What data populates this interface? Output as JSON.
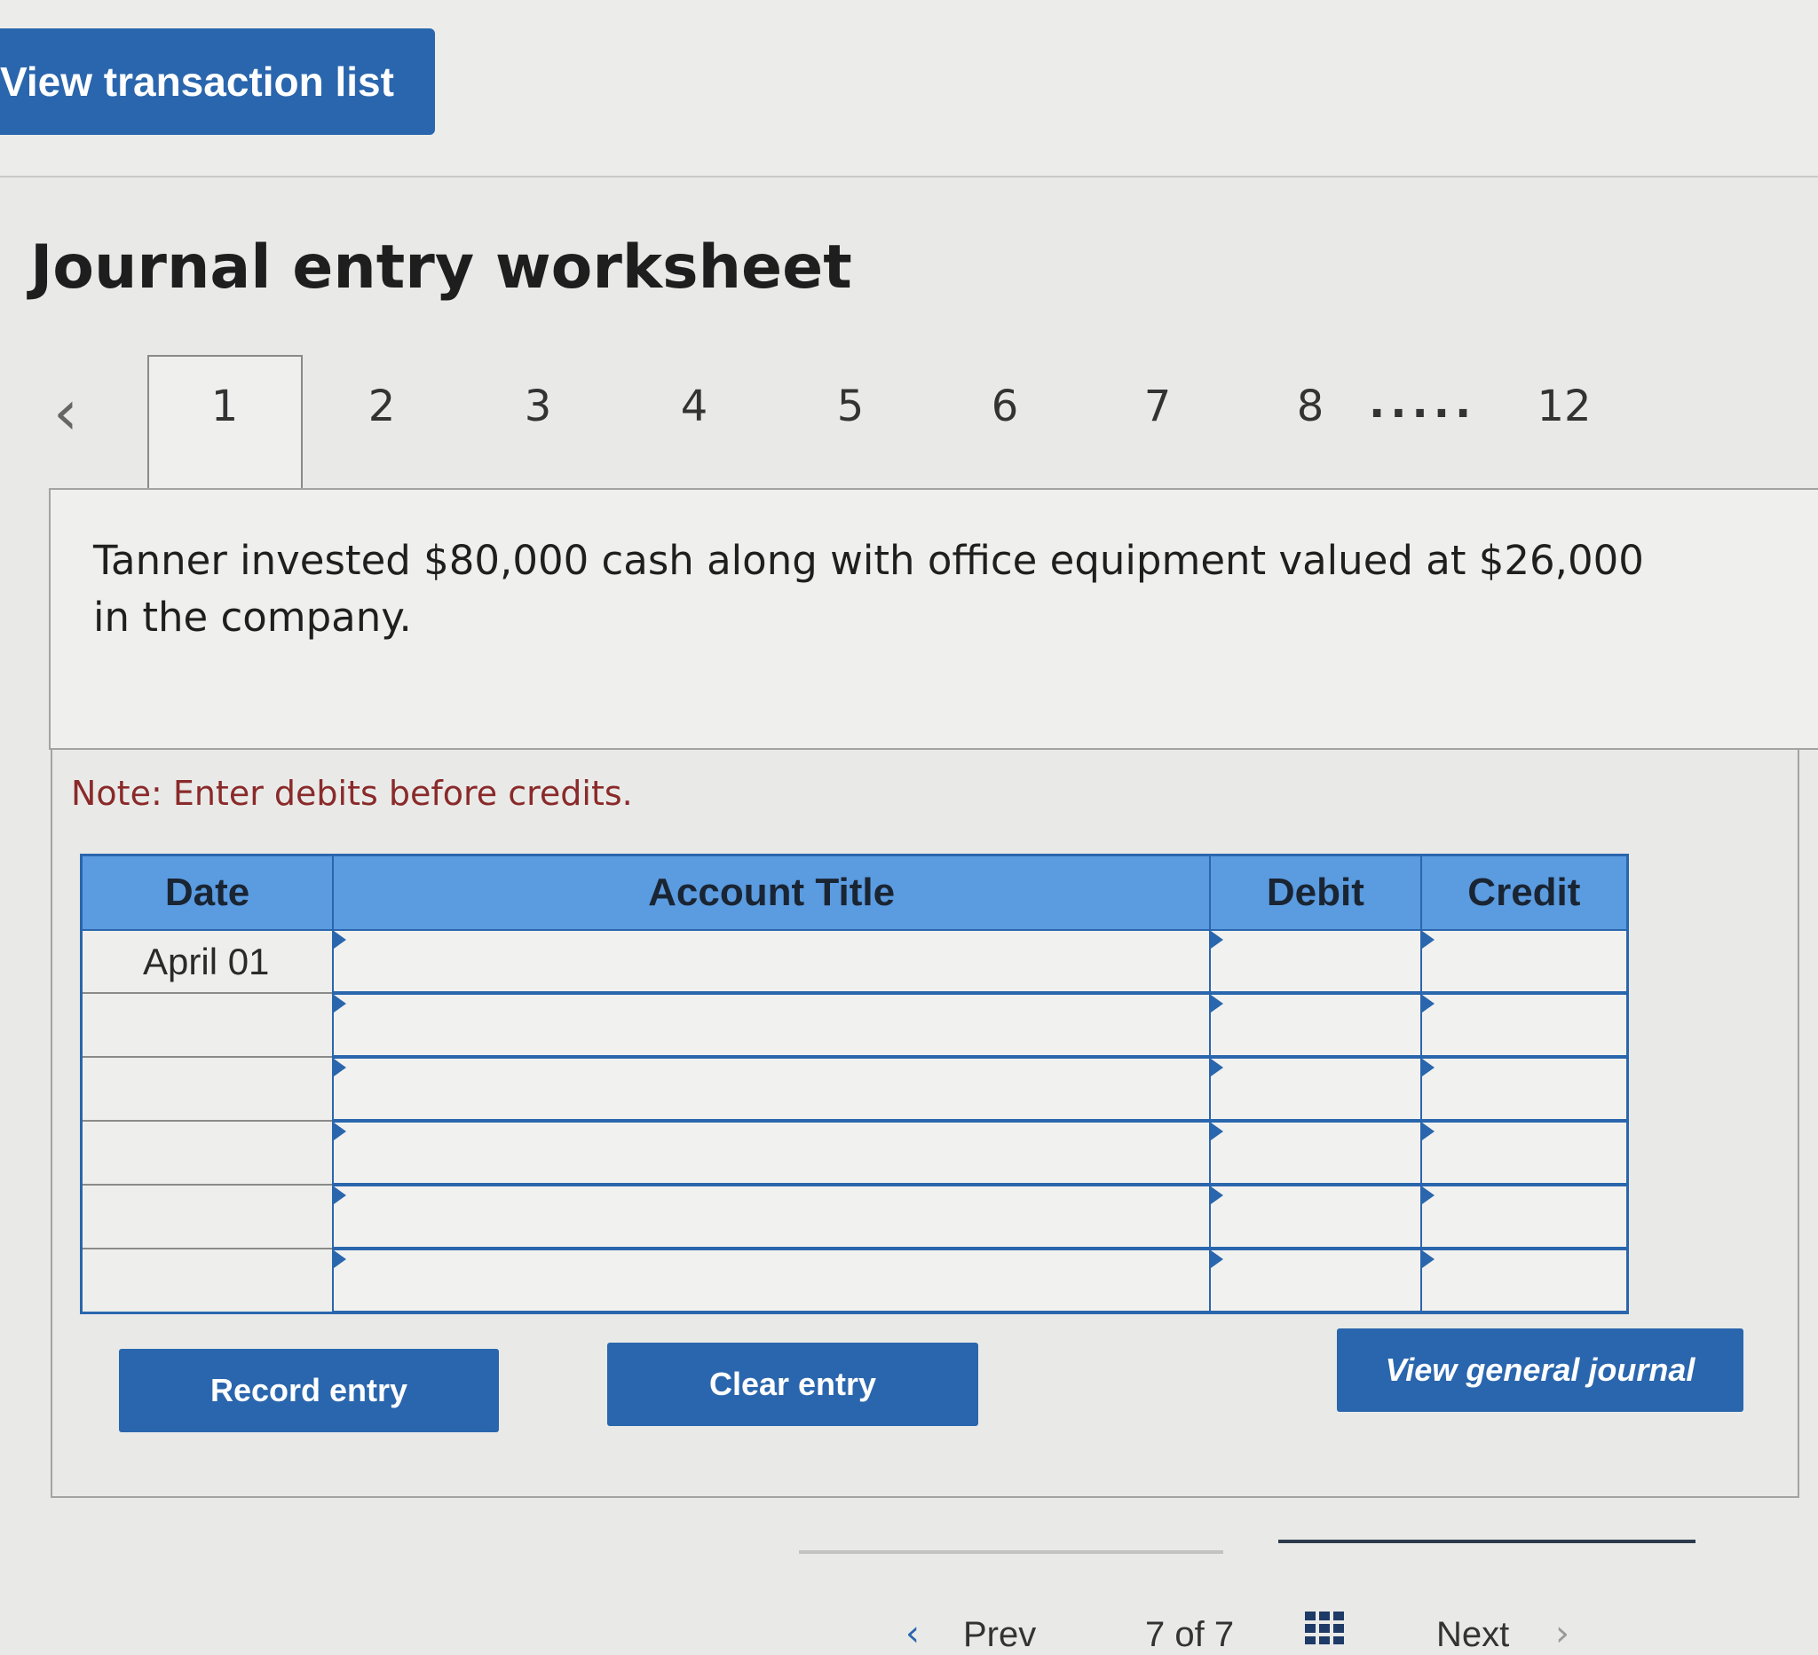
{
  "header": {
    "view_transaction_list_label": "View transaction list"
  },
  "page_title": "Journal entry worksheet",
  "tabs": {
    "prev_icon": "chevron-left-icon",
    "items": [
      "1",
      "2",
      "3",
      "4",
      "5",
      "6",
      "7",
      "8",
      "12"
    ],
    "ellipsis": ".....",
    "active": "1"
  },
  "question": "Tanner invested $80,000 cash along with office equipment valued at $26,000 in the company.",
  "note": "Note: Enter debits before credits.",
  "journal": {
    "headers": {
      "date": "Date",
      "account_title": "Account Title",
      "debit": "Debit",
      "credit": "Credit"
    },
    "rows": [
      {
        "date": "April 01",
        "account": "",
        "debit": "",
        "credit": ""
      },
      {
        "date": "",
        "account": "",
        "debit": "",
        "credit": ""
      },
      {
        "date": "",
        "account": "",
        "debit": "",
        "credit": ""
      },
      {
        "date": "",
        "account": "",
        "debit": "",
        "credit": ""
      },
      {
        "date": "",
        "account": "",
        "debit": "",
        "credit": ""
      },
      {
        "date": "",
        "account": "",
        "debit": "",
        "credit": ""
      }
    ]
  },
  "buttons": {
    "record_entry": "Record entry",
    "clear_entry": "Clear entry",
    "view_general_journal": "View general journal"
  },
  "footer": {
    "prev_label": "Prev",
    "page_current": "7",
    "page_of": "of",
    "page_total": "7",
    "next_label": "Next",
    "grid_icon": "grid-icon"
  },
  "colors": {
    "primary_button": "#2a66ad",
    "table_header": "#5b9be0",
    "note_text": "#8a2a2a"
  }
}
